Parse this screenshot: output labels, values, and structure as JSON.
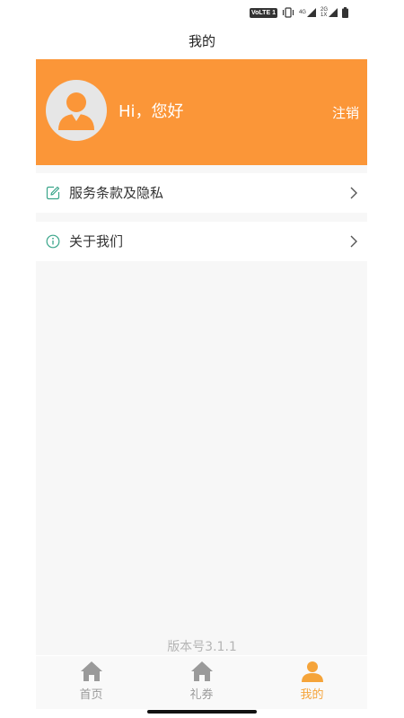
{
  "status_bar": {
    "volte": "VoLTE 1",
    "net1": "4G",
    "net2_top": "2G",
    "net2_bottom": "1X"
  },
  "nav": {
    "title": "我的"
  },
  "profile": {
    "greeting": "Hi，您好",
    "logout_label": "注销",
    "avatar_icon": "user-avatar-icon"
  },
  "menu": {
    "items": [
      {
        "label": "服务条款及隐私",
        "icon": "edit-icon"
      },
      {
        "label": "关于我们",
        "icon": "info-icon"
      }
    ]
  },
  "version": "版本号3.1.1",
  "tabbar": {
    "tabs": [
      {
        "label": "首页",
        "icon": "home-icon",
        "active": false
      },
      {
        "label": "礼券",
        "icon": "home-icon",
        "active": false
      },
      {
        "label": "我的",
        "icon": "user-icon",
        "active": true
      }
    ]
  },
  "colors": {
    "accent": "#fb9638",
    "tab_active": "#f5a43a",
    "tab_inactive": "#9a9a9a",
    "icon_green": "#3aa58a"
  }
}
